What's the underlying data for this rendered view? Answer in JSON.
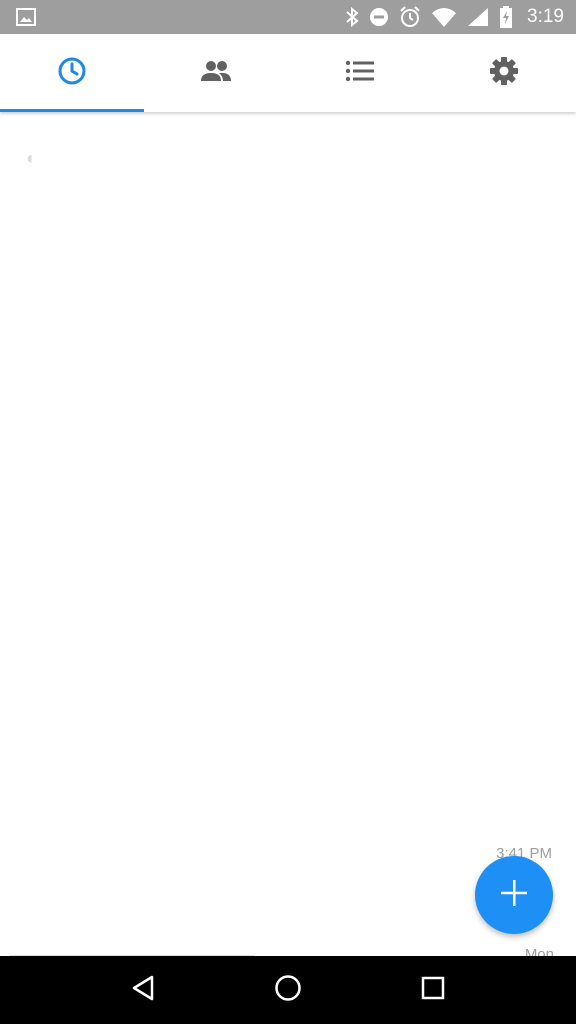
{
  "status_bar": {
    "time": "3:19",
    "icons": [
      "image-icon",
      "bluetooth-icon",
      "do-not-disturb-icon",
      "alarm-icon",
      "wifi-icon",
      "signal-icon",
      "battery-charging-icon"
    ],
    "background": "#9e9e9e"
  },
  "tabs": [
    {
      "name": "recents",
      "icon": "clock-icon",
      "active": true
    },
    {
      "name": "contacts",
      "icon": "people-icon",
      "active": false
    },
    {
      "name": "lists",
      "icon": "list-icon",
      "active": false
    },
    {
      "name": "settings",
      "icon": "gear-icon",
      "active": false
    }
  ],
  "accent_color": "#1e88e5",
  "content": {
    "partial_time": "3:41 PM",
    "partial_day": "Mon"
  },
  "fab": {
    "icon": "plus-icon"
  },
  "nav_bar": {
    "buttons": [
      "back-icon",
      "home-icon",
      "recents-icon"
    ]
  }
}
